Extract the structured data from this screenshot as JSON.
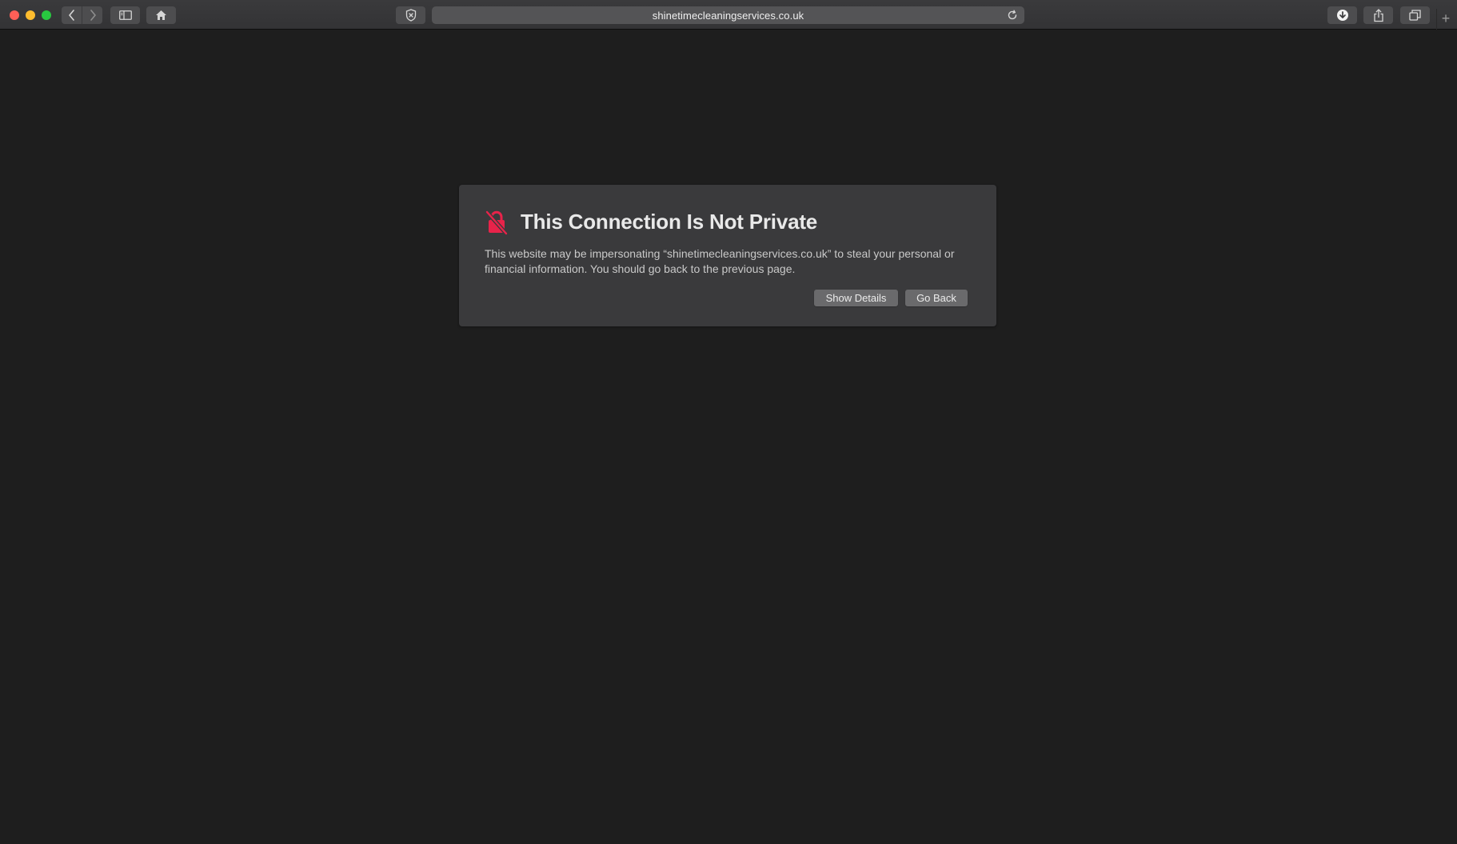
{
  "browser": {
    "url": "shinetimecleaningservices.co.uk",
    "traffic_lights": {
      "close": "#ff5f57",
      "minimize": "#febc2e",
      "zoom": "#28c840"
    },
    "toolbar": {
      "back_icon": "chevron-left-icon",
      "forward_icon": "chevron-right-icon",
      "sidebar_icon": "sidebar-icon",
      "home_icon": "home-icon",
      "privacy_icon": "shield-icon",
      "reload_icon": "reload-icon",
      "download_icon": "download-icon",
      "share_icon": "share-icon",
      "tabs_icon": "tabs-overview-icon",
      "new_tab_label": "+"
    }
  },
  "warning": {
    "icon": "lock-slash-icon",
    "icon_color": "#e8234a",
    "title": "This Connection Is Not Private",
    "body": "This website may be impersonating “shinetimecleaningservices.co.uk” to steal your personal or financial information. You should go back to the previous page.",
    "show_details_label": "Show Details",
    "go_back_label": "Go Back"
  }
}
